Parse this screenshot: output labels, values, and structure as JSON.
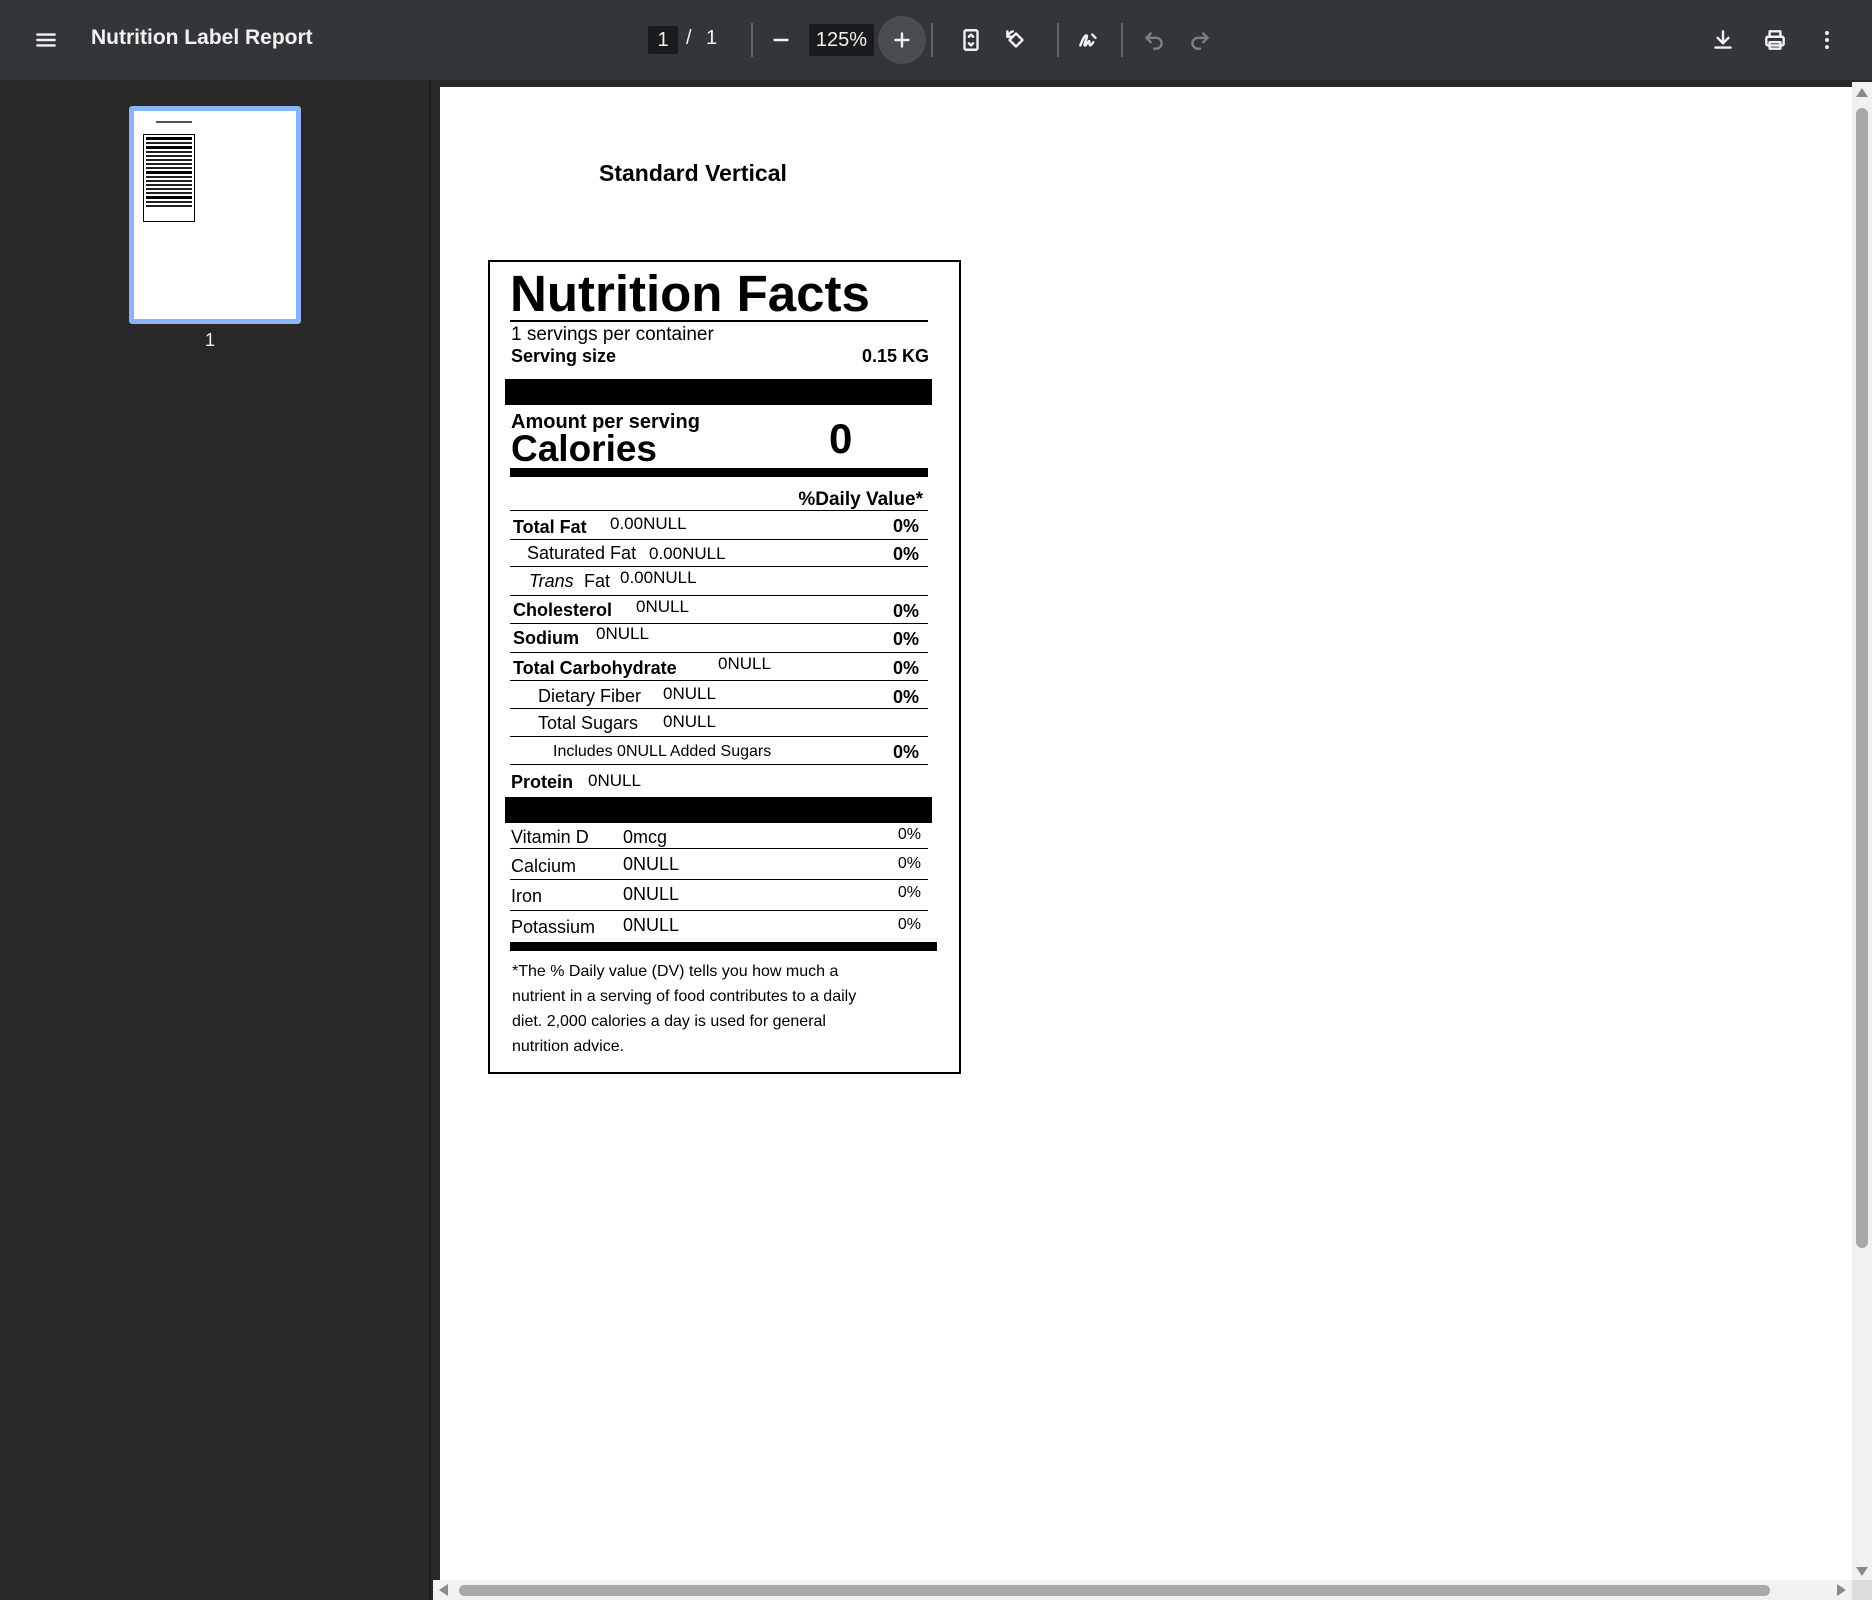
{
  "toolbar": {
    "title": "Nutrition Label Report",
    "page_current": "1",
    "page_separator": "/",
    "page_total": "1",
    "zoom": "125%"
  },
  "sidebar": {
    "thumbnail_page": "1"
  },
  "document": {
    "report_title": "Standard Vertical",
    "label": {
      "heading": "Nutrition Facts",
      "servings_per_container": "1 servings per container",
      "serving_size_label": "Serving size",
      "serving_size_value": "0.15 KG",
      "amount_per_serving": "Amount per serving",
      "calories_label": "Calories",
      "calories_value": "0",
      "daily_value_header": "%Daily Value*",
      "nutrients": {
        "total_fat": {
          "name": "Total Fat",
          "amount": "0.00NULL",
          "dv": "0%"
        },
        "saturated_fat": {
          "name": "Saturated Fat",
          "amount": "0.00NULL",
          "dv": "0%"
        },
        "trans_fat": {
          "name_italic": "Trans",
          "name": "Fat",
          "amount": "0.00NULL"
        },
        "cholesterol": {
          "name": "Cholesterol",
          "amount": "0NULL",
          "dv": "0%"
        },
        "sodium": {
          "name": "Sodium",
          "amount": "0NULL",
          "dv": "0%"
        },
        "total_carbohydrate": {
          "name": "Total Carbohydrate",
          "amount": "0NULL",
          "dv": "0%"
        },
        "dietary_fiber": {
          "name": "Dietary Fiber",
          "amount": "0NULL",
          "dv": "0%"
        },
        "total_sugars": {
          "name": "Total Sugars",
          "amount": "0NULL"
        },
        "added_sugars": {
          "text": "Includes 0NULL Added Sugars",
          "dv": "0%"
        },
        "protein": {
          "name": "Protein",
          "amount": "0NULL"
        }
      },
      "vitamins": {
        "vitamin_d": {
          "name": "Vitamin D",
          "amount": "0mcg",
          "dv": "0%"
        },
        "calcium": {
          "name": "Calcium",
          "amount": "0NULL",
          "dv": "0%"
        },
        "iron": {
          "name": "Iron",
          "amount": "0NULL",
          "dv": "0%"
        },
        "potassium": {
          "name": "Potassium",
          "amount": "0NULL",
          "dv": "0%"
        }
      },
      "footnote": [
        "*The % Daily value (DV) tells you how much a",
        "nutrient in a serving of food contributes to a daily",
        "diet. 2,000 calories a day is used for general",
        "nutrition advice."
      ]
    }
  }
}
